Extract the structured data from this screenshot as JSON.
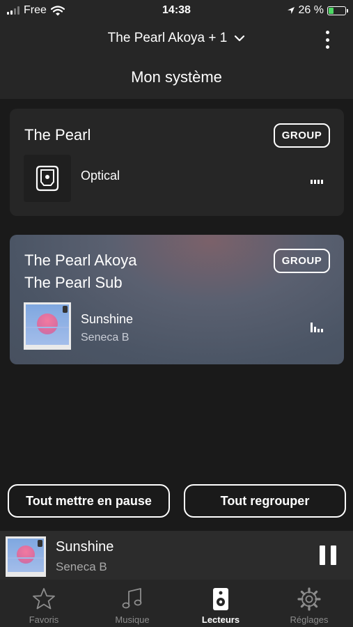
{
  "status_bar": {
    "carrier": "Free",
    "time": "14:38",
    "battery": "26 %",
    "battery_level": 0.26
  },
  "header": {
    "device_selector": "The Pearl Akoya + 1",
    "title": "Mon système"
  },
  "cards": [
    {
      "name_lines": [
        "The Pearl"
      ],
      "group_label": "GROUP",
      "source": "Optical"
    },
    {
      "name_lines": [
        "The Pearl Akoya",
        "The Pearl Sub"
      ],
      "group_label": "GROUP",
      "track_title": "Sunshine",
      "track_artist": "Seneca B"
    }
  ],
  "actions": {
    "pause_all": "Tout mettre en pause",
    "group_all": "Tout regrouper"
  },
  "now_playing": {
    "title": "Sunshine",
    "artist": "Seneca B"
  },
  "tabs": [
    {
      "label": "Favoris",
      "icon": "star-icon",
      "active": false
    },
    {
      "label": "Musique",
      "icon": "music-note-icon",
      "active": false
    },
    {
      "label": "Lecteurs",
      "icon": "speaker-icon",
      "active": true
    },
    {
      "label": "Réglages",
      "icon": "gear-icon",
      "active": false
    }
  ],
  "colors": {
    "background": "#1a1a1a",
    "card": "#262626",
    "active_card": "#4b5565",
    "accent_battery": "#4cd964"
  }
}
